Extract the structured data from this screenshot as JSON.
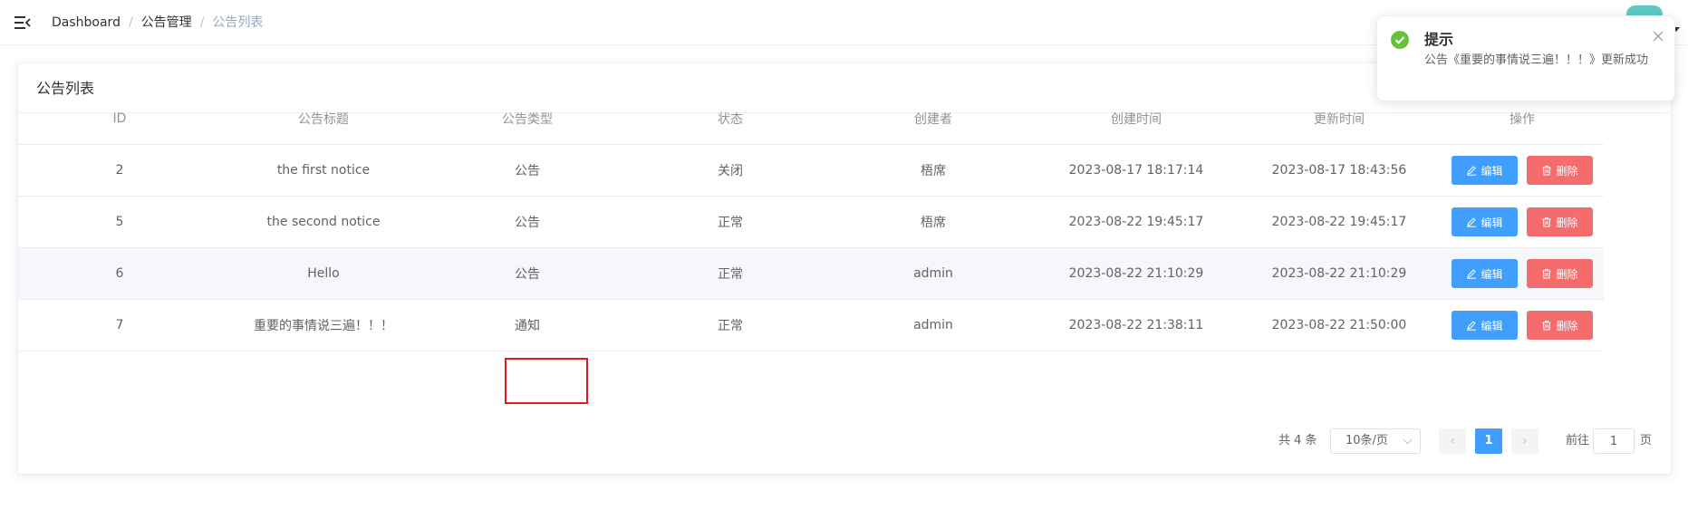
{
  "breadcrumb": [
    "Dashboard",
    "公告管理",
    "公告列表"
  ],
  "breadcrumb_sep": "/",
  "card": {
    "title": "公告列表"
  },
  "table": {
    "columns": [
      "ID",
      "公告标题",
      "公告类型",
      "状态",
      "创建者",
      "创建时间",
      "更新时间",
      "操作"
    ],
    "rows": [
      {
        "id": "2",
        "title": "the first notice",
        "type": "公告",
        "status": "关闭",
        "creator": "梧席",
        "created": "2023-08-17 18:17:14",
        "updated": "2023-08-17 18:43:56"
      },
      {
        "id": "5",
        "title": "the second notice",
        "type": "公告",
        "status": "正常",
        "creator": "梧席",
        "created": "2023-08-22 19:45:17",
        "updated": "2023-08-22 19:45:17"
      },
      {
        "id": "6",
        "title": "Hello",
        "type": "公告",
        "status": "正常",
        "creator": "admin",
        "created": "2023-08-22 21:10:29",
        "updated": "2023-08-22 21:10:29"
      },
      {
        "id": "7",
        "title": "重要的事情说三遍！！！",
        "type": "通知",
        "status": "正常",
        "creator": "admin",
        "created": "2023-08-22 21:38:11",
        "updated": "2023-08-22 21:50:00"
      }
    ],
    "edit_label": "编辑",
    "delete_label": "删除"
  },
  "pagination": {
    "total_text": "共 4 条",
    "page_size": "10条/页",
    "prev": "‹",
    "current_page": "1",
    "next": "›",
    "goto_label": "前往",
    "goto_value": "1",
    "page_suffix": "页"
  },
  "toast": {
    "title": "提示",
    "message": "公告《重要的事情说三遍！！！》更新成功"
  },
  "colors": {
    "primary": "#409eff",
    "danger": "#f56c6c",
    "success": "#67c23a",
    "highlight": "#e41b1b"
  }
}
